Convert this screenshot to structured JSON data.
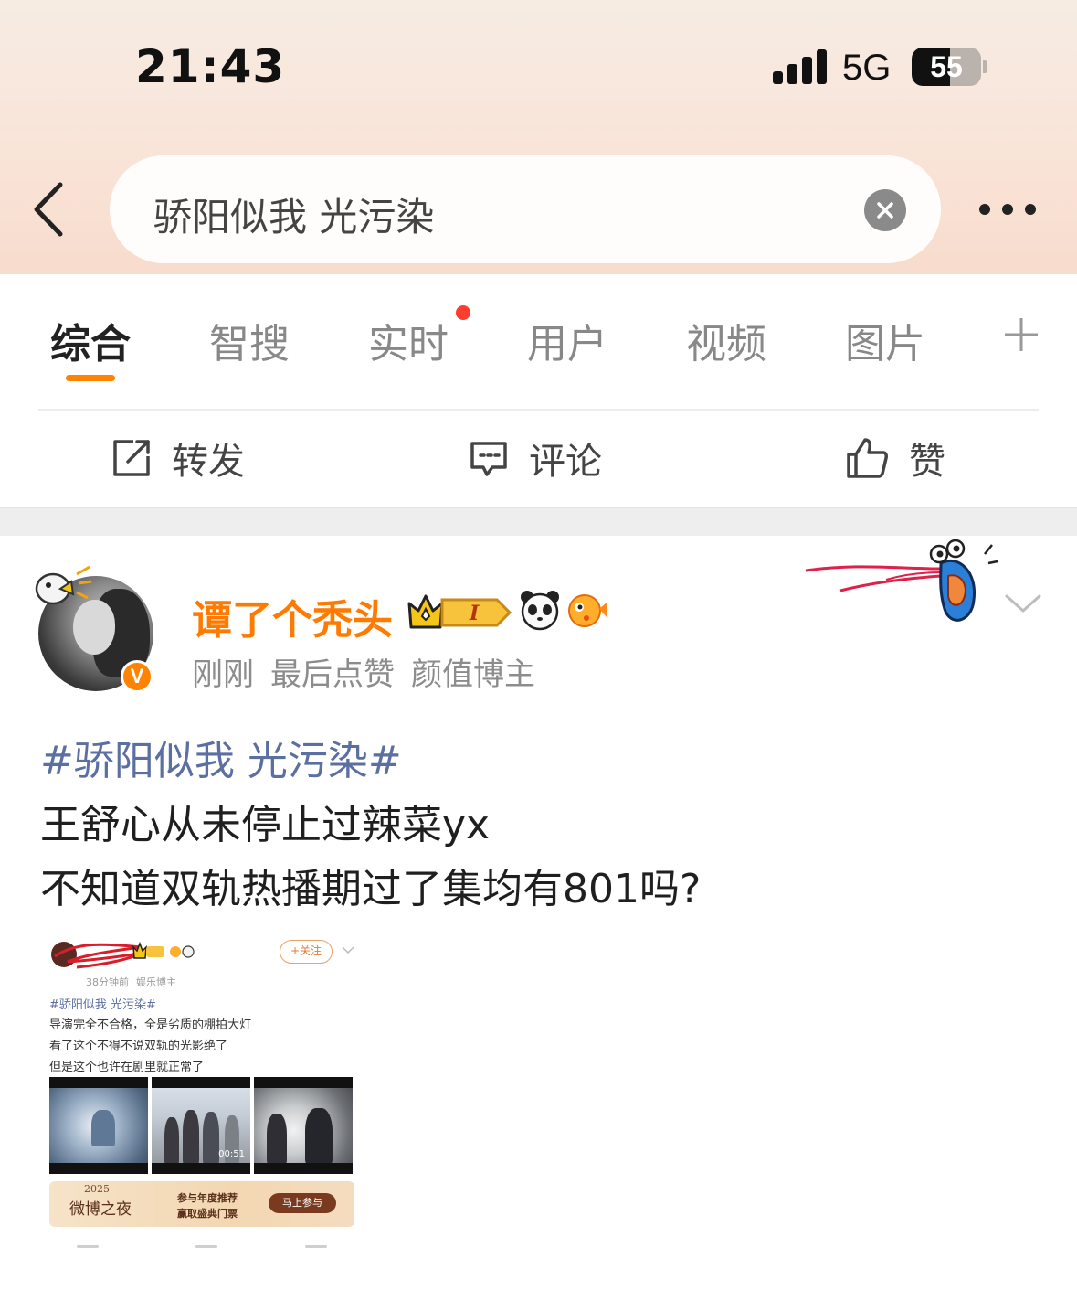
{
  "status_bar": {
    "time": "21:43",
    "network": "5G",
    "battery_percent": "55",
    "battery_level": 0.55
  },
  "search": {
    "query": "骄阳似我 光污染",
    "back_icon": "chevron-left-icon",
    "clear_icon": "clear-circle-icon",
    "more_icon": "more-dots-icon"
  },
  "tabs": [
    {
      "label": "综合",
      "active": true
    },
    {
      "label": "智搜"
    },
    {
      "label": "实时",
      "has_red_dot": true
    },
    {
      "label": "用户"
    },
    {
      "label": "视频"
    },
    {
      "label": "图片"
    }
  ],
  "actions": {
    "repost": "转发",
    "comment": "评论",
    "like": "赞"
  },
  "post": {
    "username": "谭了个秃头",
    "meta": [
      "刚刚",
      "最后点赞",
      "颜值博主"
    ],
    "topic": "#骄阳似我 光污染#",
    "lines": [
      "王舒心从未停止过辣菜yx",
      "不知道双轨热播期过了集均有801吗?"
    ],
    "verified_badge": "V",
    "accent_color": "#ff7a00",
    "topic_color": "#5b6fa0"
  },
  "embedded_screenshot": {
    "follow_label": "+关注",
    "meta": [
      "38分钟前",
      "娱乐博主"
    ],
    "topic": "#骄阳似我 光污染#",
    "lines": [
      "导演完全不合格，全是劣质的棚拍大灯",
      "看了这个不得不说双轨的光影绝了",
      "但是这个也许在剧里就正常了"
    ],
    "video_duration": "00:51",
    "banner": {
      "year": "2025",
      "logo": "微博之夜",
      "line1": "参与年度推荐",
      "line2": "赢取盛典门票",
      "button": "马上参与"
    }
  }
}
